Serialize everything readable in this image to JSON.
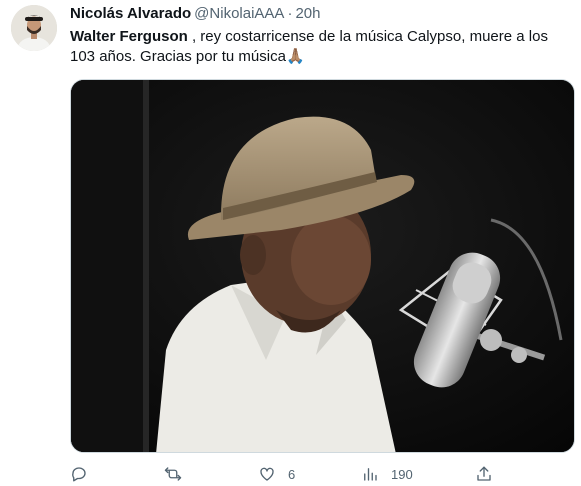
{
  "tweet": {
    "author_name": "Nicolás Alvarado",
    "handle": "@NikolaiAAA",
    "separator": "·",
    "time": "20h",
    "text_bold": "Walter Ferguson",
    "text_rest": " , rey costarricense de la música Calypso, muere a los 103 años. Gracias por tu música",
    "emoji": "🙏🏽"
  },
  "actions": {
    "reply_count": "",
    "retweet_count": "",
    "like_count": "6",
    "views_count": "190"
  },
  "icons": [
    "reply-icon",
    "retweet-icon",
    "like-icon",
    "views-icon",
    "share-icon"
  ]
}
